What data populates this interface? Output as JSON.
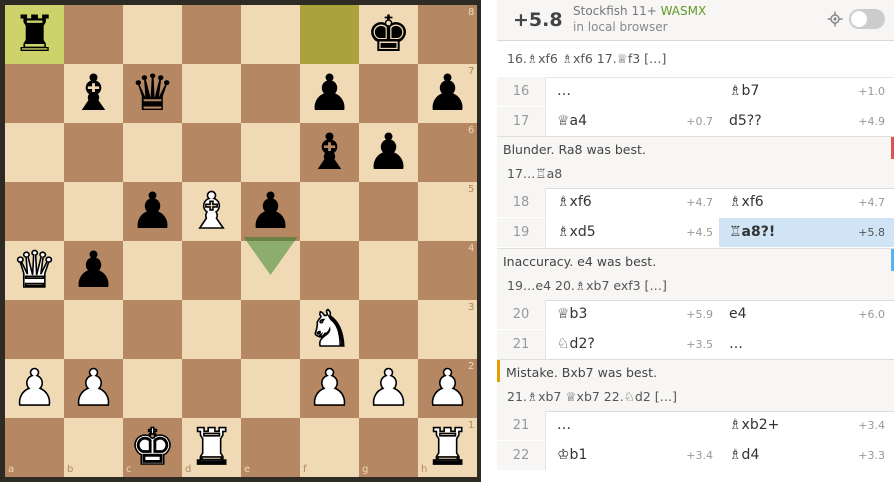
{
  "board": {
    "files": [
      "a",
      "b",
      "c",
      "d",
      "e",
      "f",
      "g",
      "h"
    ],
    "ranks": [
      "8",
      "7",
      "6",
      "5",
      "4",
      "3",
      "2",
      "1"
    ],
    "highlights": [
      "a8",
      "f8"
    ],
    "pieces": [
      {
        "square": "a8",
        "color": "black",
        "type": "rook",
        "glyph": "♜"
      },
      {
        "square": "g8",
        "color": "black",
        "type": "king",
        "glyph": "♚"
      },
      {
        "square": "b7",
        "color": "black",
        "type": "bishop",
        "glyph": "♝"
      },
      {
        "square": "c7",
        "color": "black",
        "type": "queen",
        "glyph": "♛"
      },
      {
        "square": "f7",
        "color": "black",
        "type": "pawn",
        "glyph": "♟"
      },
      {
        "square": "h7",
        "color": "black",
        "type": "pawn",
        "glyph": "♟"
      },
      {
        "square": "f6",
        "color": "black",
        "type": "bishop",
        "glyph": "♝"
      },
      {
        "square": "g6",
        "color": "black",
        "type": "pawn",
        "glyph": "♟"
      },
      {
        "square": "c5",
        "color": "black",
        "type": "pawn",
        "glyph": "♟"
      },
      {
        "square": "d5",
        "color": "white",
        "type": "bishop",
        "glyph": "♝"
      },
      {
        "square": "e5",
        "color": "black",
        "type": "pawn",
        "glyph": "♟"
      },
      {
        "square": "a4",
        "color": "white",
        "type": "queen",
        "glyph": "♛"
      },
      {
        "square": "b4",
        "color": "black",
        "type": "pawn",
        "glyph": "♟"
      },
      {
        "square": "f3",
        "color": "white",
        "type": "knight",
        "glyph": "♞"
      },
      {
        "square": "a2",
        "color": "white",
        "type": "pawn",
        "glyph": "♟"
      },
      {
        "square": "b2",
        "color": "white",
        "type": "pawn",
        "glyph": "♟"
      },
      {
        "square": "f2",
        "color": "white",
        "type": "pawn",
        "glyph": "♟"
      },
      {
        "square": "g2",
        "color": "white",
        "type": "pawn",
        "glyph": "♟"
      },
      {
        "square": "h2",
        "color": "white",
        "type": "pawn",
        "glyph": "♟"
      },
      {
        "square": "c1",
        "color": "white",
        "type": "king",
        "glyph": "♚"
      },
      {
        "square": "d1",
        "color": "white",
        "type": "rook",
        "glyph": "♜"
      },
      {
        "square": "h1",
        "color": "white",
        "type": "rook",
        "glyph": "♜"
      }
    ],
    "arrow": {
      "from": "e5",
      "to": "e4",
      "color": "#15781b"
    }
  },
  "engine": {
    "eval": "+5.8",
    "name": "Stockfish 11+",
    "variant": "WASMX",
    "location": "in local browser"
  },
  "moves": {
    "top_line": "16.♗xf6 ♗xf6 17.♕f3 […]",
    "rows": [
      {
        "num": "16",
        "white": "…",
        "white_eval": "",
        "black": "♗b7",
        "black_eval": "+1.0"
      },
      {
        "num": "17",
        "white": "♕a4",
        "white_eval": "+0.7",
        "black": "d5??",
        "black_eval": "+4.9"
      }
    ],
    "comment1": {
      "text": "Blunder. Ra8 was best.",
      "line": "17…♖a8",
      "color": "#df5353"
    },
    "rows2": [
      {
        "num": "18",
        "white": "♗xf6",
        "white_eval": "+4.7",
        "black": "♗xf6",
        "black_eval": "+4.7"
      },
      {
        "num": "19",
        "white": "♗xd5",
        "white_eval": "+4.5",
        "black": "♖a8?!",
        "black_eval": "+5.8"
      }
    ],
    "comment2": {
      "text": "Inaccuracy. e4 was best.",
      "line": "19…e4 20.♗xb7 exf3 […]",
      "color": "#56b4e9"
    },
    "rows3": [
      {
        "num": "20",
        "white": "♕b3",
        "white_eval": "+5.9",
        "black": "e4",
        "black_eval": "+6.0"
      },
      {
        "num": "21",
        "white": "♘d2?",
        "white_eval": "+3.5",
        "black": "…",
        "black_eval": ""
      }
    ],
    "comment3": {
      "text": "Mistake. Bxb7 was best.",
      "line": "21.♗xb7 ♕xb7 22.♘d2 […]",
      "color": "#e69f00"
    },
    "rows4": [
      {
        "num": "21",
        "white": "…",
        "white_eval": "",
        "black": "♗xb2+",
        "black_eval": "+3.4"
      },
      {
        "num": "22",
        "white": "♔b1",
        "white_eval": "+3.4",
        "black": "♗d4",
        "black_eval": "+3.3"
      }
    ]
  }
}
